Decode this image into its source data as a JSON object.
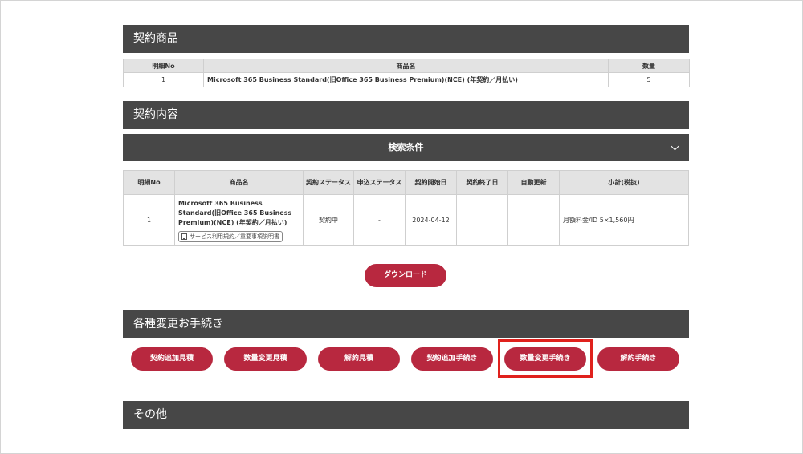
{
  "contract_products": {
    "title": "契約商品",
    "columns": [
      "明細No",
      "商品名",
      "数量"
    ],
    "rows": [
      {
        "no": "1",
        "name": "Microsoft 365 Business Standard(旧Office 365 Business Premium)(NCE) (年契約／月払い)",
        "qty": "5"
      }
    ]
  },
  "contract_details": {
    "title": "契約内容",
    "search_label": "検索条件",
    "columns": [
      "明細No",
      "商品名",
      "契約ステータス",
      "申込ステータス",
      "契約開始日",
      "契約終了日",
      "自動更新",
      "小計(税抜)"
    ],
    "rows": [
      {
        "no": "1",
        "name": "Microsoft 365 Business Standard(旧Office 365 Business Premium)(NCE) (年契約／月払い)",
        "doc_link": "サービス利用規約／重要事項説明書",
        "contract_status": "契約中",
        "application_status": "-",
        "start_date": "2024-04-12",
        "end_date": "",
        "auto_renew": "",
        "subtotal": "月額料金/ID 5×1,560円"
      }
    ]
  },
  "download_label": "ダウンロード",
  "procedures": {
    "title": "各種変更お手続き",
    "buttons": [
      "契約追加見積",
      "数量変更見積",
      "解約見積",
      "契約追加手続き",
      "数量変更手続き",
      "解約手続き"
    ]
  },
  "other": {
    "title": "その他"
  },
  "colors": {
    "bar": "#474747",
    "button": "#b8283f",
    "highlight": "#e0211d",
    "header_cell": "#e3e3e3"
  }
}
